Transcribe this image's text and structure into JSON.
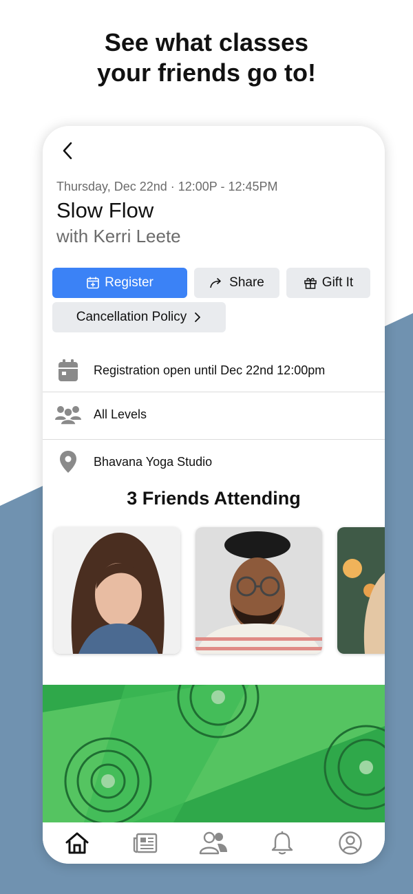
{
  "promo": {
    "headline_line1": "See what classes",
    "headline_line2": "your friends go to!"
  },
  "class": {
    "datetime": "Thursday, Dec 22nd · 12:00P - 12:45PM",
    "title": "Slow Flow",
    "instructor": "with Kerri Leete"
  },
  "actions": {
    "register_label": "Register",
    "share_label": "Share",
    "gift_label": "Gift It",
    "cancellation_label": "Cancellation Policy"
  },
  "info": {
    "registration": "Registration open until Dec 22nd 12:00pm",
    "level": "All Levels",
    "location": "Bhavana Yoga Studio"
  },
  "friends": {
    "title": "3 Friends Attending"
  },
  "tabbar": {
    "items": [
      "home-icon",
      "newspaper-icon",
      "people-icon",
      "bell-icon",
      "profile-icon"
    ]
  },
  "colors": {
    "accent": "#3b82f6",
    "background_shape": "#7092b0",
    "button_gray": "#e9ebee",
    "icon_gray": "#8a8a8a",
    "banner_green": "#2fa84a"
  }
}
